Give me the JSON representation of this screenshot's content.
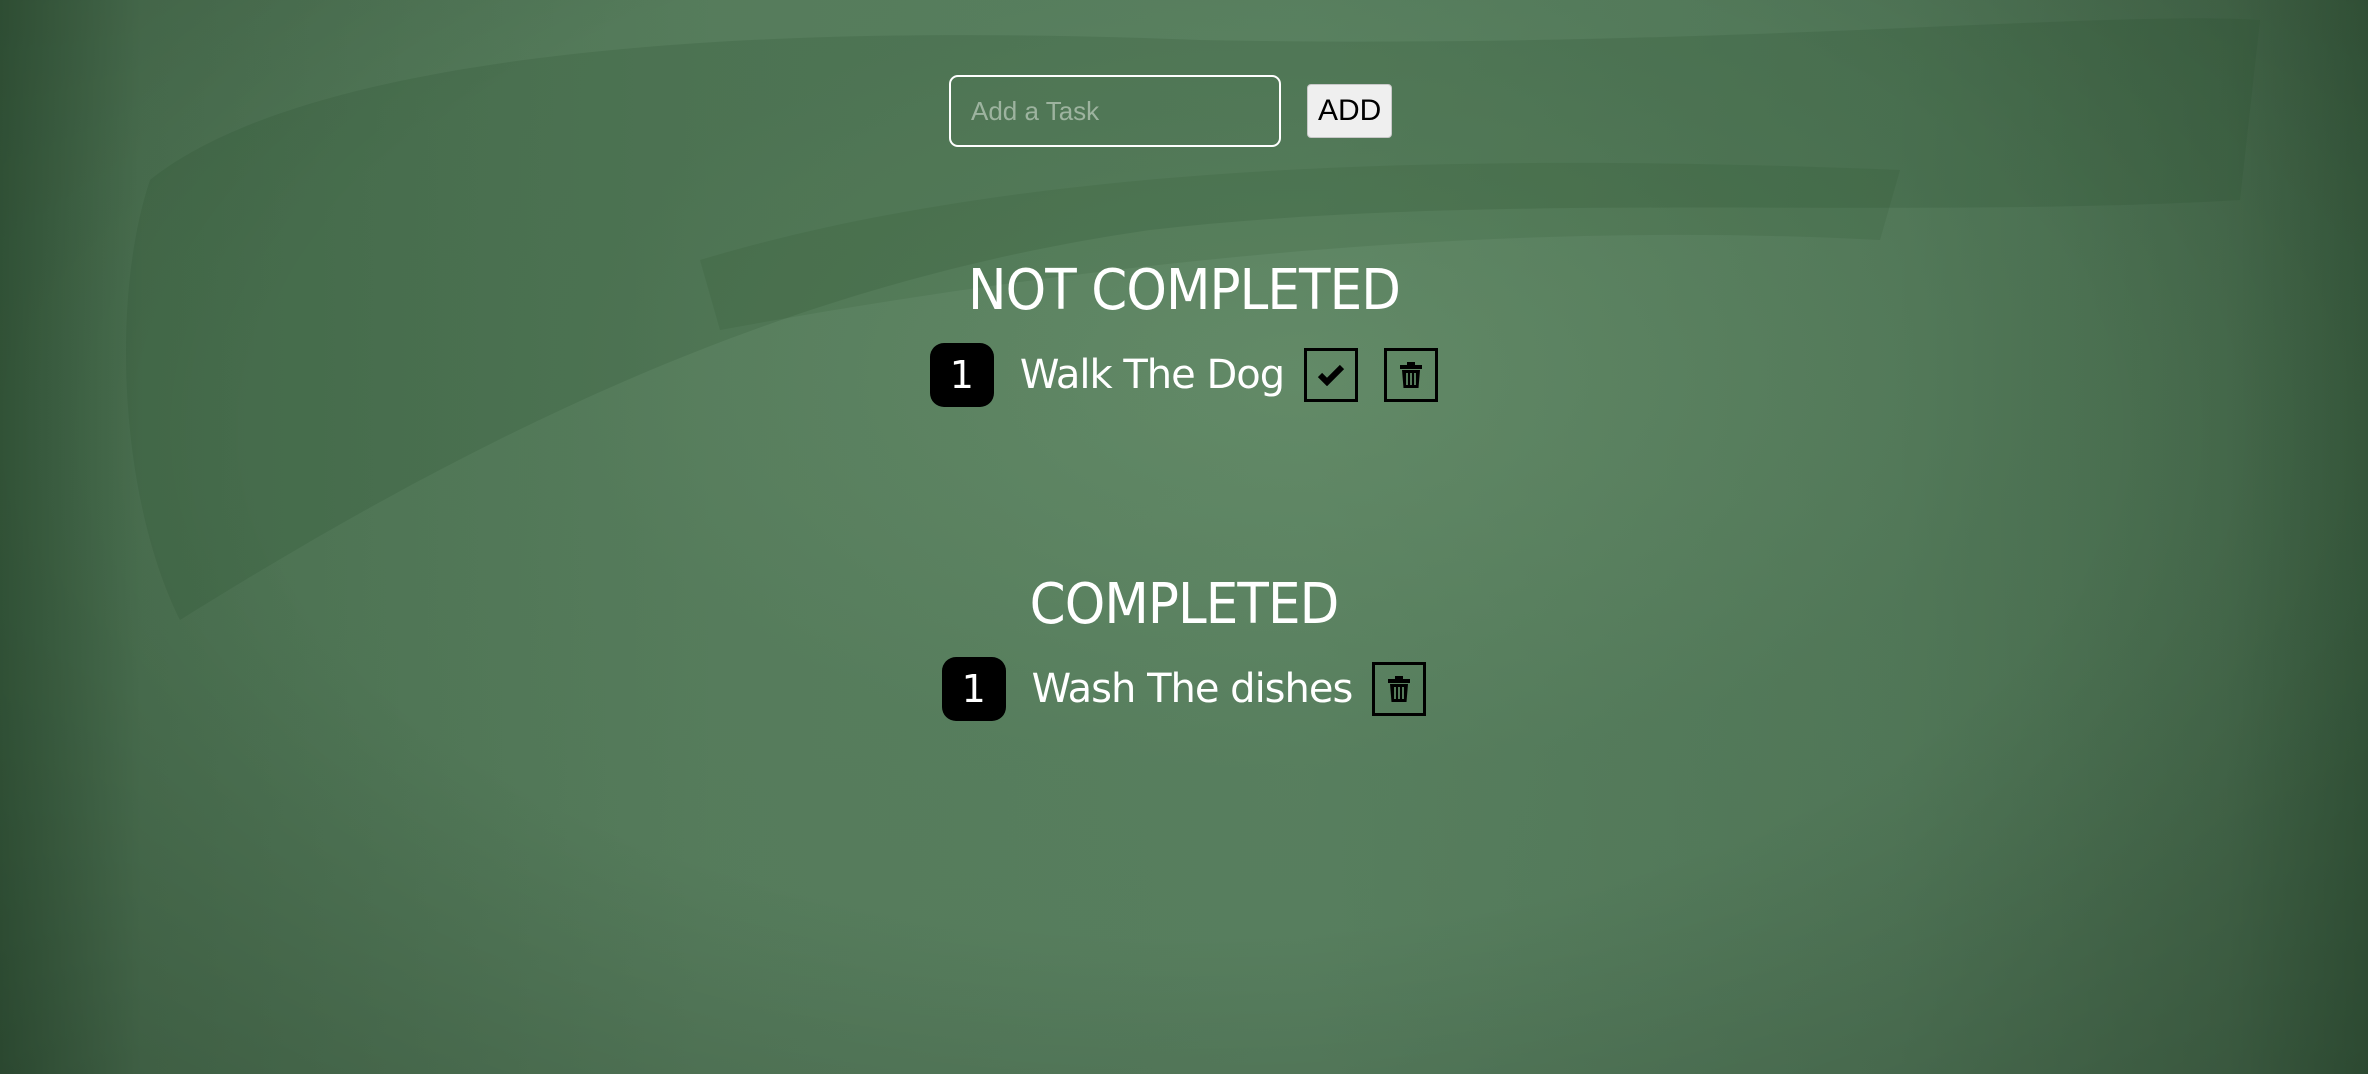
{
  "add_form": {
    "input_placeholder": "Add a Task",
    "input_value": "",
    "add_label": "ADD"
  },
  "not_completed": {
    "title": "NOT COMPLETED",
    "tasks": [
      {
        "number": "1",
        "text": "Walk The Dog",
        "actions": [
          "check-icon",
          "trash-icon"
        ]
      }
    ]
  },
  "completed": {
    "title": "COMPLETED",
    "tasks": [
      {
        "number": "1",
        "text": "Wash The dishes",
        "actions": [
          "trash-icon"
        ]
      }
    ]
  },
  "colors": {
    "background": "#557b5b",
    "text": "#ffffff",
    "badge": "#000000"
  }
}
